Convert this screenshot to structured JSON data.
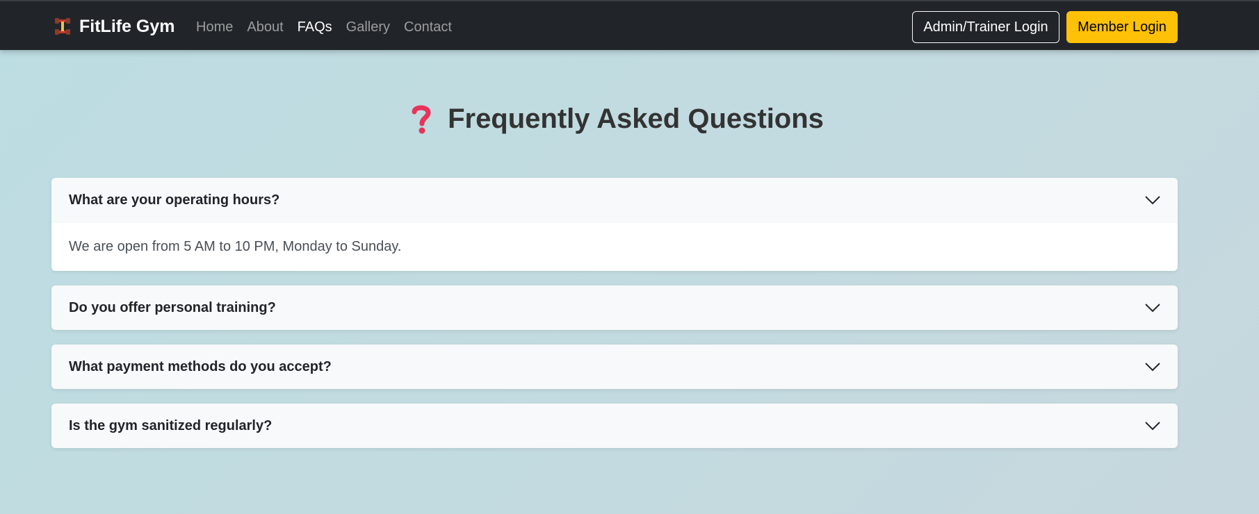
{
  "navbar": {
    "brand": "FitLife Gym",
    "brand_icon": "dumbbell-icon",
    "links": [
      {
        "label": "Home"
      },
      {
        "label": "About"
      },
      {
        "label": "FAQs"
      },
      {
        "label": "Gallery"
      },
      {
        "label": "Contact"
      }
    ],
    "admin_login_label": "Admin/Trainer Login",
    "member_login_label": "Member Login",
    "active_link": "FAQs"
  },
  "main": {
    "title": "Frequently Asked Questions",
    "title_icon": "question-mark-icon",
    "faqs": [
      {
        "question": "What are your operating hours?",
        "answer": "We are open from 5 AM to 10 PM, Monday to Sunday.",
        "expanded": true
      },
      {
        "question": "Do you offer personal training?",
        "expanded": false
      },
      {
        "question": "What payment methods do you accept?",
        "expanded": false
      },
      {
        "question": "Is the gym sanitized regularly?",
        "expanded": false
      }
    ]
  },
  "colors": {
    "navbar_bg": "#212529",
    "accent_yellow": "#ffc107",
    "question_mark_red": "#e8335a"
  }
}
